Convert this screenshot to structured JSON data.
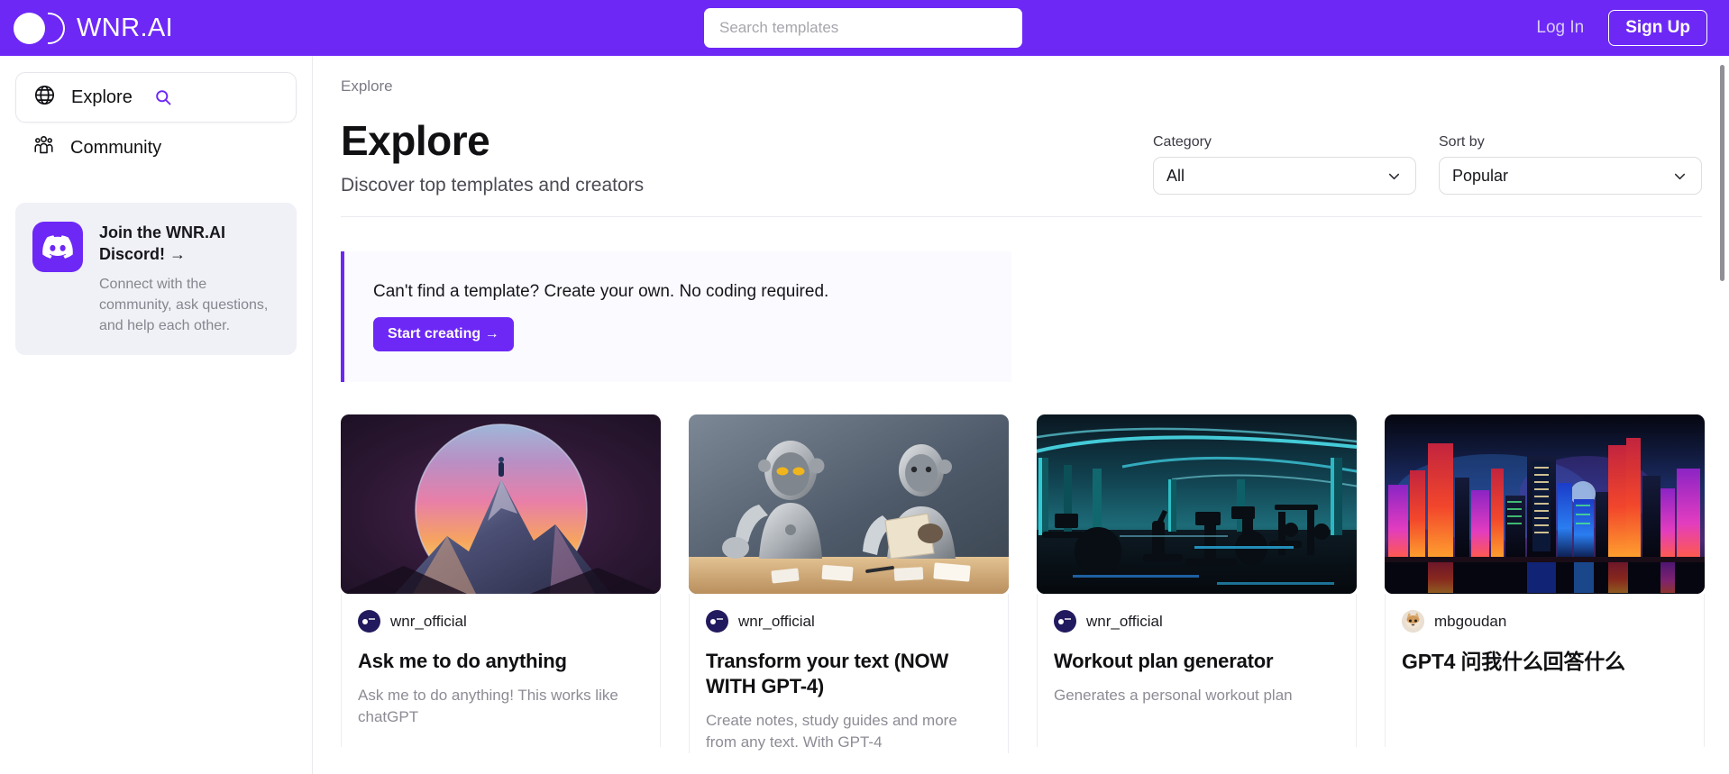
{
  "header": {
    "brand_name": "WNR.AI",
    "search_placeholder": "Search templates",
    "search_value": "",
    "login_label": "Log In",
    "signup_label": "Sign Up",
    "brand_color": "#6d28f6"
  },
  "sidebar": {
    "items": [
      {
        "label": "Explore",
        "icon": "globe-icon",
        "active": true,
        "trailing_icon": "search-icon"
      },
      {
        "label": "Community",
        "icon": "people-group-icon",
        "active": false
      }
    ],
    "discord_card": {
      "title": "Join the WNR.AI Discord! →",
      "description": "Connect with the community, ask questions, and help each other.",
      "icon": "discord-icon",
      "icon_bg": "#6d28f6"
    }
  },
  "main": {
    "breadcrumb": "Explore",
    "page_title": "Explore",
    "page_subtitle": "Discover top templates and creators",
    "filters": [
      {
        "label": "Category",
        "value": "All",
        "icon": "chevron-down-icon"
      },
      {
        "label": "Sort by",
        "value": "Popular",
        "icon": "chevron-down-icon"
      }
    ],
    "callout": {
      "text": "Can't find a template? Create your own. No coding required.",
      "button_label": "Start creating →",
      "accent_color": "#6d28f6"
    },
    "cards": [
      {
        "author": "wnr_official",
        "avatar_type": "wnr-logo",
        "title": "Ask me to do anything",
        "description": "Ask me to do anything! This works like chatGPT",
        "image_alt": "person-on-mountain-peak-inside-sunset-sphere"
      },
      {
        "author": "wnr_official",
        "avatar_type": "wnr-logo",
        "title": "Transform your text (NOW WITH GPT-4)",
        "description": "Create notes, study guides and more from any text. With GPT-4",
        "image_alt": "two-robots-at-desk-with-papers"
      },
      {
        "author": "wnr_official",
        "avatar_type": "wnr-logo",
        "title": "Workout plan generator",
        "description": "Generates a personal workout plan",
        "image_alt": "futuristic-neon-lit-gym-interior"
      },
      {
        "author": "mbgoudan",
        "avatar_type": "cat-photo",
        "title": "GPT4 问我什么回答什么",
        "description": "",
        "image_alt": "neon-cyberpunk-city-skyline-at-night"
      }
    ]
  }
}
